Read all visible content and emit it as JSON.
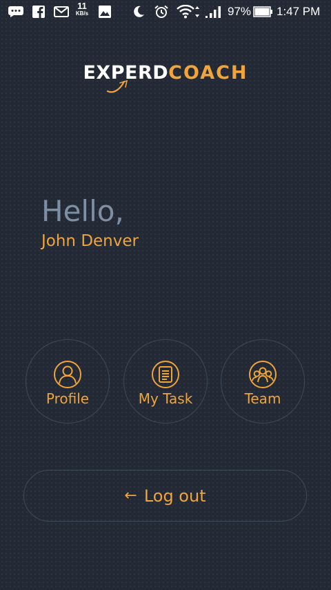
{
  "status_bar": {
    "network_speed_value": "11",
    "network_speed_unit": "KB/s",
    "battery_percent": "97%",
    "time": "1:47 PM",
    "icons": [
      "chat-icon",
      "facebook-icon",
      "gmail-icon",
      "image-icon",
      "moon-icon",
      "alarm-icon",
      "wifi-icon",
      "signal-icon",
      "battery-icon"
    ]
  },
  "logo": {
    "part1": "EXPERD",
    "part2": "COACH"
  },
  "greeting": {
    "hello": "Hello,",
    "name": "John Denver"
  },
  "menu": {
    "profile_label": "Profile",
    "task_label": "My Task",
    "team_label": "Team"
  },
  "logout": {
    "arrow": "←",
    "label": "Log out"
  },
  "colors": {
    "background": "#232a35",
    "accent": "#f0a43a",
    "muted": "#7f8fa3",
    "outline": "#3d4a5a"
  }
}
